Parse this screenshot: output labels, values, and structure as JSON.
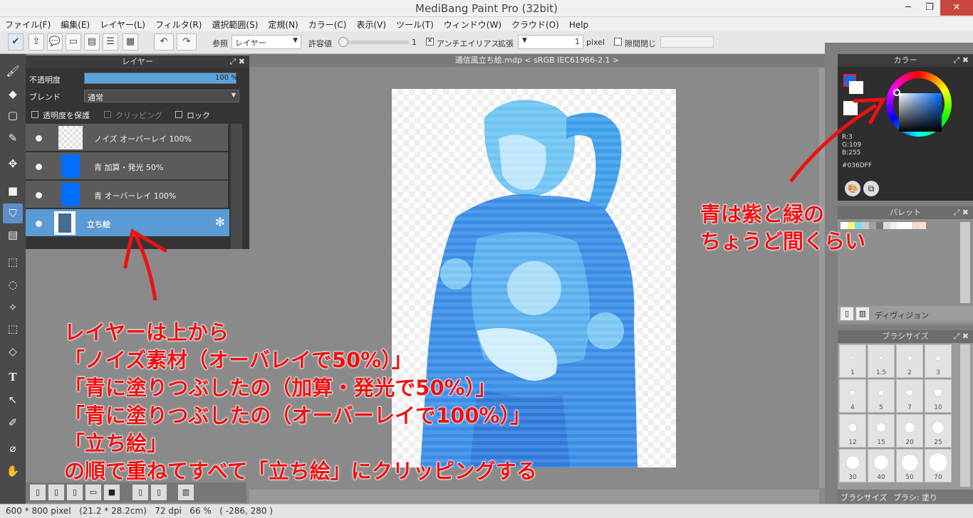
{
  "window": {
    "title": "MediBang Paint Pro (32bit)",
    "minimize": "─",
    "restore": "❐",
    "close": "✕"
  },
  "menu": [
    "ファイル(F)",
    "編集(E)",
    "レイヤー(L)",
    "フィルタ(R)",
    "選択範囲(S)",
    "定規(N)",
    "カラー(C)",
    "表示(V)",
    "ツール(T)",
    "ウィンドウ(W)",
    "クラウド(O)",
    "Help"
  ],
  "toolbar": {
    "ref_label": "参照",
    "ref_value": "レイヤー",
    "tolerance_label": "許容値",
    "tolerance_value": "1",
    "antialias_label": "アンチエイリアス",
    "expand_label": "拡張",
    "expand_value": "1",
    "expand_unit": "pixel",
    "gap_label": "隙間閉じ"
  },
  "layer_panel": {
    "title": "レイヤー",
    "opacity_label": "不透明度",
    "opacity_value": "100 %",
    "opacity_fraction": 1.0,
    "blend_label": "ブレンド",
    "blend_value": "通常",
    "protect_label": "透明度を保護",
    "clipping_label": "クリッピング",
    "lock_label": "ロック",
    "layers": [
      {
        "name": "ノイズ オーバーレイ 100%"
      },
      {
        "name": "青 加算・発光 50%"
      },
      {
        "name": "青 オーバーレイ 100%"
      },
      {
        "name": "立ち絵"
      }
    ]
  },
  "document": {
    "tab": "通信風立ち絵.mdp < sRGB IEC61966-2.1 >"
  },
  "color_panel": {
    "title": "カラー",
    "rgb": [
      "R:3",
      "G:109",
      "B:255"
    ],
    "hex": "#036DFF",
    "current_color": "#036dff"
  },
  "palette_panel": {
    "title": "パレット",
    "division_label": "ディヴィジョン"
  },
  "brush_size_panel": {
    "title": "ブラシサイズ",
    "sizes": [
      "1",
      "1.5",
      "2",
      "3",
      "4",
      "5",
      "7",
      "10",
      "12",
      "15",
      "20",
      "25",
      "30",
      "40",
      "50",
      "70"
    ],
    "tab1": "ブラシサイズ",
    "tab2": "ブラシ: 塗り"
  },
  "status": {
    "text": "600 * 800 pixel   (21.2 * 28.2cm)   72 dpi   66 %   ( -286, 280 )"
  },
  "annotations": {
    "right": [
      "青は紫と緑の",
      "ちょうど間くらい"
    ],
    "main": [
      "レイヤーは上から",
      "「ノイズ素材（オーバレイで50%）」",
      "「青に塗りつぶしたの（加算・発光で50%）」",
      "「青に塗りつぶしたの（オーバーレイで100%）」",
      "「立ち絵」",
      "の順で重ねてすべて「立ち絵」にクリッピングする"
    ]
  }
}
